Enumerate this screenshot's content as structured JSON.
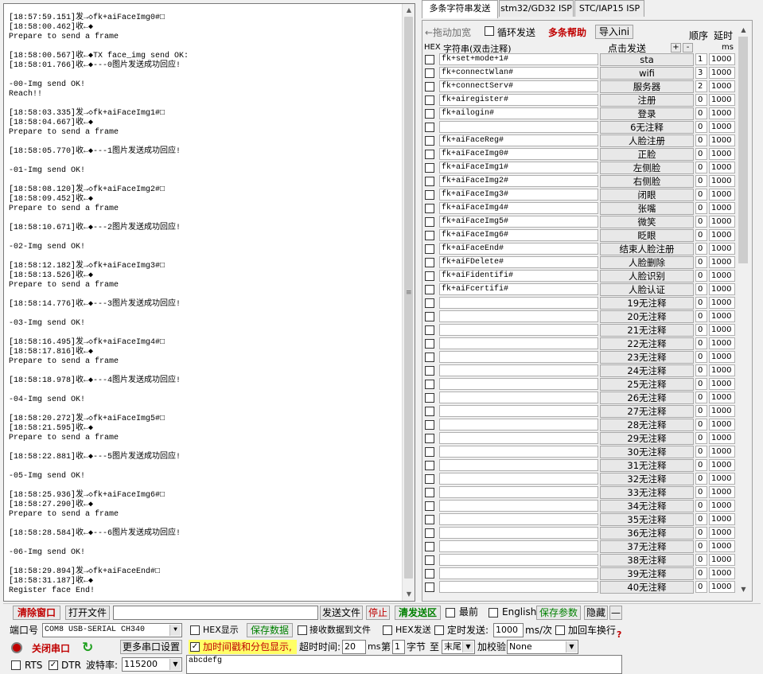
{
  "receive_lines": [
    "[18:57:59.151]发→◇fk+aiFaceImg0#□",
    "[18:58:00.462]收←◆",
    "Prepare to send a frame",
    "",
    "[18:58:00.567]收←◆TX face_img send OK:",
    "[18:58:01.766]收←◆---0图片发送成功回应!",
    "",
    "-00-Img send OK!",
    "Reach!!",
    "",
    "[18:58:03.335]发→◇fk+aiFaceImg1#□",
    "[18:58:04.667]收←◆",
    "Prepare to send a frame",
    "",
    "[18:58:05.770]收←◆---1图片发送成功回应!",
    "",
    "-01-Img send OK!",
    "",
    "[18:58:08.120]发→◇fk+aiFaceImg2#□",
    "[18:58:09.452]收←◆",
    "Prepare to send a frame",
    "",
    "[18:58:10.671]收←◆---2图片发送成功回应!",
    "",
    "-02-Img send OK!",
    "",
    "[18:58:12.182]发→◇fk+aiFaceImg3#□",
    "[18:58:13.526]收←◆",
    "Prepare to send a frame",
    "",
    "[18:58:14.776]收←◆---3图片发送成功回应!",
    "",
    "-03-Img send OK!",
    "",
    "[18:58:16.495]发→◇fk+aiFaceImg4#□",
    "[18:58:17.816]收←◆",
    "Prepare to send a frame",
    "",
    "[18:58:18.978]收←◆---4图片发送成功回应!",
    "",
    "-04-Img send OK!",
    "",
    "[18:58:20.272]发→◇fk+aiFaceImg5#□",
    "[18:58:21.595]收←◆",
    "Prepare to send a frame",
    "",
    "[18:58:22.881]收←◆---5图片发送成功回应!",
    "",
    "-05-Img send OK!",
    "",
    "[18:58:25.936]发→◇fk+aiFaceImg6#□",
    "[18:58:27.290]收←◆",
    "Prepare to send a frame",
    "",
    "[18:58:28.584]收←◆---6图片发送成功回应!",
    "",
    "-06-Img send OK!",
    "",
    "[18:58:29.894]发→◇fk+aiFaceEnd#□",
    "[18:58:31.187]收←◆",
    "Register face End!"
  ],
  "tabs": [
    "多条字符串发送",
    "stm32/GD32 ISP",
    "STC/IAP15 ISP"
  ],
  "panel": {
    "drag_resize": "←拖动加宽",
    "loop_send": "循环发送",
    "multi_help": "多条帮助",
    "import_ini": "导入ini",
    "order": "顺序",
    "delay": "延时",
    "hex": "HEX",
    "string_header": "字符串(双击注释)",
    "click_send": "点击发送",
    "plus": "+",
    "minus": "-",
    "ms": "ms"
  },
  "rows": [
    {
      "text": "fk+set+mode+1#",
      "btn": "sta",
      "ord": "1",
      "dly": "1000"
    },
    {
      "text": "fk+connectWlan#",
      "btn": "wifi",
      "ord": "3",
      "dly": "1000"
    },
    {
      "text": "fk+connectServ#",
      "btn": "服务器",
      "ord": "2",
      "dly": "1000"
    },
    {
      "text": "fk+airegister#",
      "btn": "注册",
      "ord": "0",
      "dly": "1000"
    },
    {
      "text": "fk+ailogin#",
      "btn": "登录",
      "ord": "0",
      "dly": "1000"
    },
    {
      "text": "",
      "btn": "6无注释",
      "ord": "0",
      "dly": "1000"
    },
    {
      "text": "fk+aiFaceReg#",
      "btn": "人脸注册",
      "ord": "0",
      "dly": "1000"
    },
    {
      "text": "fk+aiFaceImg0#",
      "btn": "正脸",
      "ord": "0",
      "dly": "1000"
    },
    {
      "text": "fk+aiFaceImg1#",
      "btn": "左侧脸",
      "ord": "0",
      "dly": "1000"
    },
    {
      "text": "fk+aiFaceImg2#",
      "btn": "右侧脸",
      "ord": "0",
      "dly": "1000"
    },
    {
      "text": "fk+aiFaceImg3#",
      "btn": "闭眼",
      "ord": "0",
      "dly": "1000"
    },
    {
      "text": "fk+aiFaceImg4#",
      "btn": "张嘴",
      "ord": "0",
      "dly": "1000"
    },
    {
      "text": "fk+aiFaceImg5#",
      "btn": "微笑",
      "ord": "0",
      "dly": "1000"
    },
    {
      "text": "fk+aiFaceImg6#",
      "btn": "眨眼",
      "ord": "0",
      "dly": "1000"
    },
    {
      "text": "fk+aiFaceEnd#",
      "btn": "结束人脸注册",
      "ord": "0",
      "dly": "1000"
    },
    {
      "text": "fk+aiFDelete#",
      "btn": "人脸删除",
      "ord": "0",
      "dly": "1000"
    },
    {
      "text": "fk+aiFidentifi#",
      "btn": "人脸识别",
      "ord": "0",
      "dly": "1000"
    },
    {
      "text": "fk+aiFcertifi#",
      "btn": "人脸认证",
      "ord": "0",
      "dly": "1000"
    },
    {
      "text": "",
      "btn": "19无注释",
      "ord": "0",
      "dly": "1000"
    },
    {
      "text": "",
      "btn": "20无注释",
      "ord": "0",
      "dly": "1000"
    },
    {
      "text": "",
      "btn": "21无注释",
      "ord": "0",
      "dly": "1000"
    },
    {
      "text": "",
      "btn": "22无注释",
      "ord": "0",
      "dly": "1000"
    },
    {
      "text": "",
      "btn": "23无注释",
      "ord": "0",
      "dly": "1000"
    },
    {
      "text": "",
      "btn": "24无注释",
      "ord": "0",
      "dly": "1000"
    },
    {
      "text": "",
      "btn": "25无注释",
      "ord": "0",
      "dly": "1000"
    },
    {
      "text": "",
      "btn": "26无注释",
      "ord": "0",
      "dly": "1000"
    },
    {
      "text": "",
      "btn": "27无注释",
      "ord": "0",
      "dly": "1000"
    },
    {
      "text": "",
      "btn": "28无注释",
      "ord": "0",
      "dly": "1000"
    },
    {
      "text": "",
      "btn": "29无注释",
      "ord": "0",
      "dly": "1000"
    },
    {
      "text": "",
      "btn": "30无注释",
      "ord": "0",
      "dly": "1000"
    },
    {
      "text": "",
      "btn": "31无注释",
      "ord": "0",
      "dly": "1000"
    },
    {
      "text": "",
      "btn": "32无注释",
      "ord": "0",
      "dly": "1000"
    },
    {
      "text": "",
      "btn": "33无注释",
      "ord": "0",
      "dly": "1000"
    },
    {
      "text": "",
      "btn": "34无注释",
      "ord": "0",
      "dly": "1000"
    },
    {
      "text": "",
      "btn": "35无注释",
      "ord": "0",
      "dly": "1000"
    },
    {
      "text": "",
      "btn": "36无注释",
      "ord": "0",
      "dly": "1000"
    },
    {
      "text": "",
      "btn": "37无注释",
      "ord": "0",
      "dly": "1000"
    },
    {
      "text": "",
      "btn": "38无注释",
      "ord": "0",
      "dly": "1000"
    },
    {
      "text": "",
      "btn": "39无注释",
      "ord": "0",
      "dly": "1000"
    },
    {
      "text": "",
      "btn": "40无注释",
      "ord": "0",
      "dly": "1000"
    }
  ],
  "bottom": {
    "clear_window": "清除窗口",
    "open_file": "打开文件",
    "send_file": "发送文件",
    "stop": "停止",
    "clear_send": "清发送区",
    "topmost": "最前",
    "english": "English",
    "save_params": "保存参数",
    "hide": "隐藏",
    "collapse": "—",
    "port_label": "端口号",
    "port_value": "COM8 USB-SERIAL CH340",
    "hex_display": "HEX显示",
    "save_data": "保存数据",
    "recv_to_file": "接收数据到文件",
    "hex_send": "HEX发送",
    "timed_send": "定时发送:",
    "timed_value": "1000",
    "timed_unit": "ms/次",
    "add_crlf": "加回车换行",
    "help_mark": "?",
    "close_port": "关闭串口",
    "more_settings": "更多串口设置",
    "timestamp_label": "加时间戳和分包显示,",
    "timeout_label": "超时时间:",
    "timeout_value": "20",
    "timeout_unit": "ms",
    "nth_label": "第",
    "nth_value": "1",
    "byte_label": "字节",
    "to_label": "至",
    "end_value": "末尾",
    "checksum_label": "加校验",
    "checksum_value": "None",
    "rts": "RTS",
    "dtr": "DTR",
    "baud_label": "波特率:",
    "baud_value": "115200",
    "send_text": "abcdefg"
  },
  "checked": {
    "loop_send": false,
    "timestamp": true,
    "dtr": true,
    "rts": false
  },
  "colors": {
    "danger": "#c00000",
    "green": "#008000",
    "timestamp_bg": "#ffff66"
  }
}
